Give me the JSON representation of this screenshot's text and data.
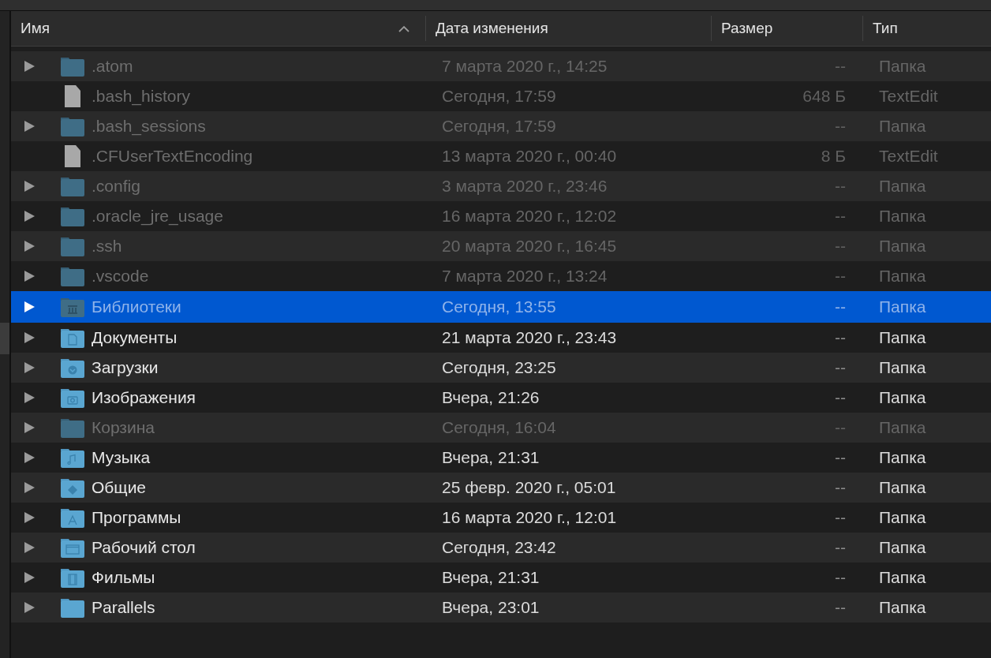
{
  "columns": [
    {
      "label": "Имя",
      "sorted": true
    },
    {
      "label": "Дата изменения",
      "sorted": false
    },
    {
      "label": "Размер",
      "sorted": false
    },
    {
      "label": "Тип",
      "sorted": false
    }
  ],
  "rows": [
    {
      "kind": "folder",
      "name": ".atom",
      "date": "7 марта 2020 г., 14:25",
      "size": "--",
      "type": "Папка",
      "hidden": true,
      "selected": false
    },
    {
      "kind": "file",
      "name": ".bash_history",
      "date": "Сегодня, 17:59",
      "size": "648 Б",
      "type": "TextEdit",
      "hidden": true,
      "selected": false
    },
    {
      "kind": "folder",
      "name": ".bash_sessions",
      "date": "Сегодня, 17:59",
      "size": "--",
      "type": "Папка",
      "hidden": true,
      "selected": false
    },
    {
      "kind": "file",
      "name": ".CFUserTextEncoding",
      "date": "13 марта 2020 г., 00:40",
      "size": "8 Б",
      "type": "TextEdit",
      "hidden": true,
      "selected": false
    },
    {
      "kind": "folder",
      "name": ".config",
      "date": "3 марта 2020 г., 23:46",
      "size": "--",
      "type": "Папка",
      "hidden": true,
      "selected": false
    },
    {
      "kind": "folder",
      "name": ".oracle_jre_usage",
      "date": "16 марта 2020 г., 12:02",
      "size": "--",
      "type": "Папка",
      "hidden": true,
      "selected": false
    },
    {
      "kind": "folder",
      "name": ".ssh",
      "date": "20 марта 2020 г., 16:45",
      "size": "--",
      "type": "Папка",
      "hidden": true,
      "selected": false
    },
    {
      "kind": "folder",
      "name": ".vscode",
      "date": "7 марта 2020 г., 13:24",
      "size": "--",
      "type": "Папка",
      "hidden": true,
      "selected": false
    },
    {
      "kind": "library",
      "name": "Библиотеки",
      "date": "Сегодня, 13:55",
      "size": "--",
      "type": "Папка",
      "hidden": true,
      "selected": true
    },
    {
      "kind": "documents",
      "name": "Документы",
      "date": "21 марта 2020 г., 23:43",
      "size": "--",
      "type": "Папка",
      "hidden": false,
      "selected": false
    },
    {
      "kind": "downloads",
      "name": "Загрузки",
      "date": "Сегодня, 23:25",
      "size": "--",
      "type": "Папка",
      "hidden": false,
      "selected": false
    },
    {
      "kind": "pictures",
      "name": "Изображения",
      "date": "Вчера, 21:26",
      "size": "--",
      "type": "Папка",
      "hidden": false,
      "selected": false
    },
    {
      "kind": "folder",
      "name": "Корзина",
      "date": "Сегодня, 16:04",
      "size": "--",
      "type": "Папка",
      "hidden": true,
      "selected": false
    },
    {
      "kind": "music",
      "name": "Музыка",
      "date": "Вчера, 21:31",
      "size": "--",
      "type": "Папка",
      "hidden": false,
      "selected": false
    },
    {
      "kind": "public",
      "name": "Общие",
      "date": "25 февр. 2020 г., 05:01",
      "size": "--",
      "type": "Папка",
      "hidden": false,
      "selected": false
    },
    {
      "kind": "apps",
      "name": "Программы",
      "date": "16 марта 2020 г., 12:01",
      "size": "--",
      "type": "Папка",
      "hidden": false,
      "selected": false
    },
    {
      "kind": "desktop",
      "name": "Рабочий стол",
      "date": "Сегодня, 23:42",
      "size": "--",
      "type": "Папка",
      "hidden": false,
      "selected": false
    },
    {
      "kind": "movies",
      "name": "Фильмы",
      "date": "Вчера, 21:31",
      "size": "--",
      "type": "Папка",
      "hidden": false,
      "selected": false
    },
    {
      "kind": "folder",
      "name": "Parallels",
      "date": "Вчера, 23:01",
      "size": "--",
      "type": "Папка",
      "hidden": false,
      "selected": false
    }
  ]
}
